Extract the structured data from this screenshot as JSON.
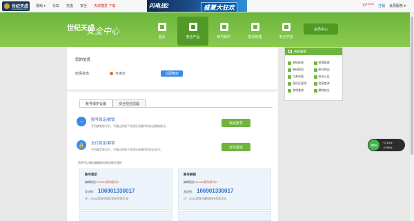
{
  "topbar": {
    "logo_text": "世纪天成",
    "logo_sub": "www.tiancity.com",
    "nav": [
      "游戏 ▾",
      "论坛",
      "充值",
      "安全",
      "天成猫爱 下载"
    ],
    "banner_left": "闪电战2",
    "banner_right": "盛夏大狂欢",
    "user": "11****** ",
    "logout": "注销",
    "service": "会员服务 ▾"
  },
  "header": {
    "logo": "世纪天成",
    "title": "安全中心",
    "nav": [
      {
        "label": "首页",
        "icon": "home-icon"
      },
      {
        "label": "安全产品",
        "icon": "shield-icon"
      },
      {
        "label": "账号保护",
        "icon": "user-lock-icon"
      },
      {
        "label": "密码管理",
        "icon": "lock-icon"
      },
      {
        "label": "安全学堂",
        "icon": "book-icon"
      }
    ],
    "center_button": "会员中心"
  },
  "account_info": {
    "title": "您的信息",
    "status_label": "密保状态：",
    "status_value": "未绑定",
    "bind_button": "立即绑定"
  },
  "tabs": [
    "账号保护设置",
    "安全短信提醒"
  ],
  "protections": [
    {
      "title": "账号锁定/解锁",
      "desc": "手机绑定账号后，可通过系统下发验证码操作的安全解锁账号。",
      "button": "锁定账号",
      "icon": "minus-circle-icon"
    },
    {
      "title": "支付锁定/解锁",
      "desc": "手机绑定账号后，可通过系统下发验证码操作的安全支付。",
      "button": "支付锁定",
      "icon": "padlock-icon"
    }
  ],
  "hint": "您还可以通过编辑短信发送账号保护",
  "cards": [
    {
      "title": "账号锁定",
      "line_prefix": "编辑短信",
      "line_highlight": "“ZHSD#您的账号#”",
      "send_label": "发送到：",
      "number": "106901330017",
      "note": "注：ZHSD是账号锁定的拼音首字母"
    },
    {
      "title": "账号解锁",
      "line_prefix": "编辑短信",
      "line_highlight": "“ZHJS#您的账号#”",
      "send_label": "发送到：",
      "number": "106901330017",
      "note": "注：ZHJS是账号解锁的拼音首字母"
    }
  ],
  "quick": {
    "title": "快捷通道",
    "items": [
      "密码修改",
      "密保管理",
      "密码找回",
      "账号找回",
      "点券充值",
      "安全认证",
      "身份证更改",
      "信息查询",
      "游戏查询",
      "解除安全"
    ]
  },
  "speed_widget": {
    "percent": "20%",
    "up": "↑ 2.1K/s",
    "down": "↓ 0.9K/s"
  }
}
